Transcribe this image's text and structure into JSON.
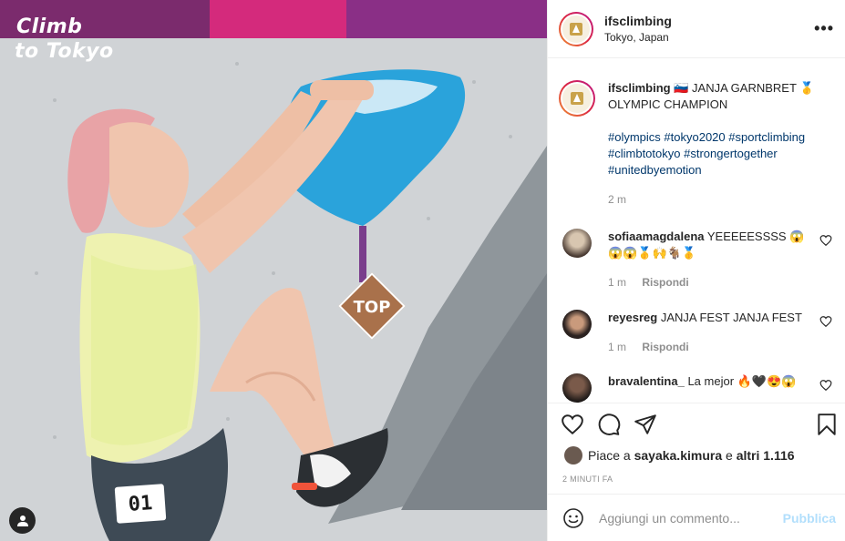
{
  "photo": {
    "brand_line1": "Climb",
    "brand_line2": "to Tokyo",
    "top_label": "TOP",
    "bib_number": "01",
    "user_tag_icon": "person-icon"
  },
  "header": {
    "username": "ifsclimbing",
    "location": "Tokyo, Japan",
    "more_icon": "•••"
  },
  "caption": {
    "username": "ifsclimbing",
    "text": "🇸🇮 JANJA GARNBRET 🥇 OLYMPIC CHAMPION",
    "hashtags": [
      "#olympics",
      "#tokyo2020",
      "#sportclimbing",
      "#climbtotokyo",
      "#strongertogether",
      "#unitedbyemotion"
    ],
    "time": "2 m"
  },
  "comments": [
    {
      "username": "sofiaamagdalena",
      "text": "YEEEEESSSS 😱😱😱🥇🙌🐐🥇",
      "time": "1 m",
      "reply": "Rispondi"
    },
    {
      "username": "reyesreg",
      "text": "JANJA FEST JANJA FEST",
      "time": "1 m",
      "reply": "Rispondi"
    },
    {
      "username": "bravalentina_",
      "text": "La mejor 🔥🖤😍😱",
      "time": "",
      "reply": ""
    }
  ],
  "actions": {
    "liked_by_prefix": "Piace a",
    "liked_by_user": "sayaka.kimura",
    "liked_by_mid": "e",
    "liked_by_others": "altri 1.116",
    "post_time": "2 MINUTI FA"
  },
  "add_comment": {
    "placeholder": "Aggiungi un commento...",
    "publish_label": "Pubblica"
  },
  "colors": {
    "hashtag": "#00376b",
    "publish_disabled": "#b2dffc",
    "hold_blue": "#2aa3db",
    "top_badge": "#a9714b"
  }
}
